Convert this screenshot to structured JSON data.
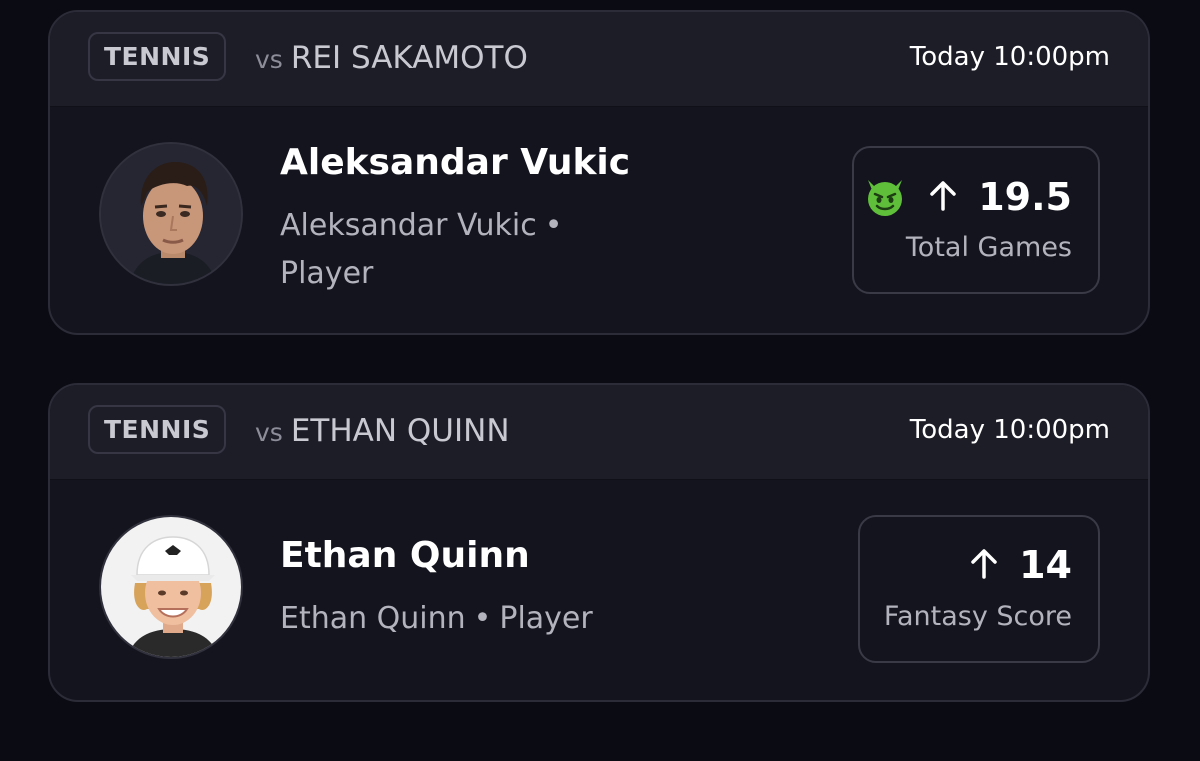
{
  "picks": [
    {
      "sport": "TENNIS",
      "vs_prefix": "vs",
      "opponent": "REI SAKAMOTO",
      "time": "Today 10:00pm",
      "player_name": "Aleksandar Vukic",
      "player_sub_line1": "Aleksandar Vukic",
      "player_sub_line2": "Player",
      "separator": "•",
      "stat_value": "19.5",
      "stat_label": "Total Games",
      "direction": "up",
      "emoji_icon": "devil-face-icon"
    },
    {
      "sport": "TENNIS",
      "vs_prefix": "vs",
      "opponent": "ETHAN QUINN",
      "time": "Today 10:00pm",
      "player_name": "Ethan Quinn",
      "player_sub_name": "Ethan Quinn",
      "player_sub_role": "Player",
      "separator": "•",
      "stat_value": "14",
      "stat_label": "Fantasy Score",
      "direction": "up"
    }
  ],
  "colors": {
    "background": "#0b0b14",
    "card": "#14141e",
    "header": "#1d1d28",
    "emoji_green": "#5fbf3a"
  }
}
